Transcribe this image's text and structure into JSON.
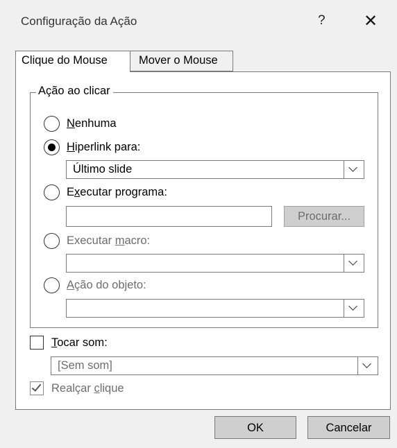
{
  "window": {
    "title": "Configuração da Ação",
    "help": "?",
    "close": "✕"
  },
  "tabs": [
    {
      "label": "Clique do Mouse",
      "active": true
    },
    {
      "label": "Mover o Mouse",
      "active": false
    }
  ],
  "group": {
    "legend": "Ação ao clicar"
  },
  "options": {
    "none": {
      "u": "N",
      "rest": "enhuma",
      "selected": false
    },
    "hyperlink": {
      "u": "H",
      "rest": "iperlink para:",
      "selected": true,
      "value": "Último slide"
    },
    "program": {
      "pre": "E",
      "u": "x",
      "rest": "ecutar programa:",
      "selected": false,
      "value": "",
      "browse": "Procurar..."
    },
    "macro": {
      "pre": "Executar ",
      "u": "m",
      "rest": "acro:",
      "selected": false,
      "value": ""
    },
    "object": {
      "u": "A",
      "rest": "ção do objeto:",
      "selected": false,
      "value": ""
    }
  },
  "sound": {
    "u": "T",
    "rest": "ocar som:",
    "checked": false,
    "value": "[Sem som]"
  },
  "highlight": {
    "pre": "Realçar ",
    "u": "c",
    "rest": "lique",
    "checked": true
  },
  "buttons": {
    "ok": "OK",
    "cancel": "Cancelar"
  }
}
